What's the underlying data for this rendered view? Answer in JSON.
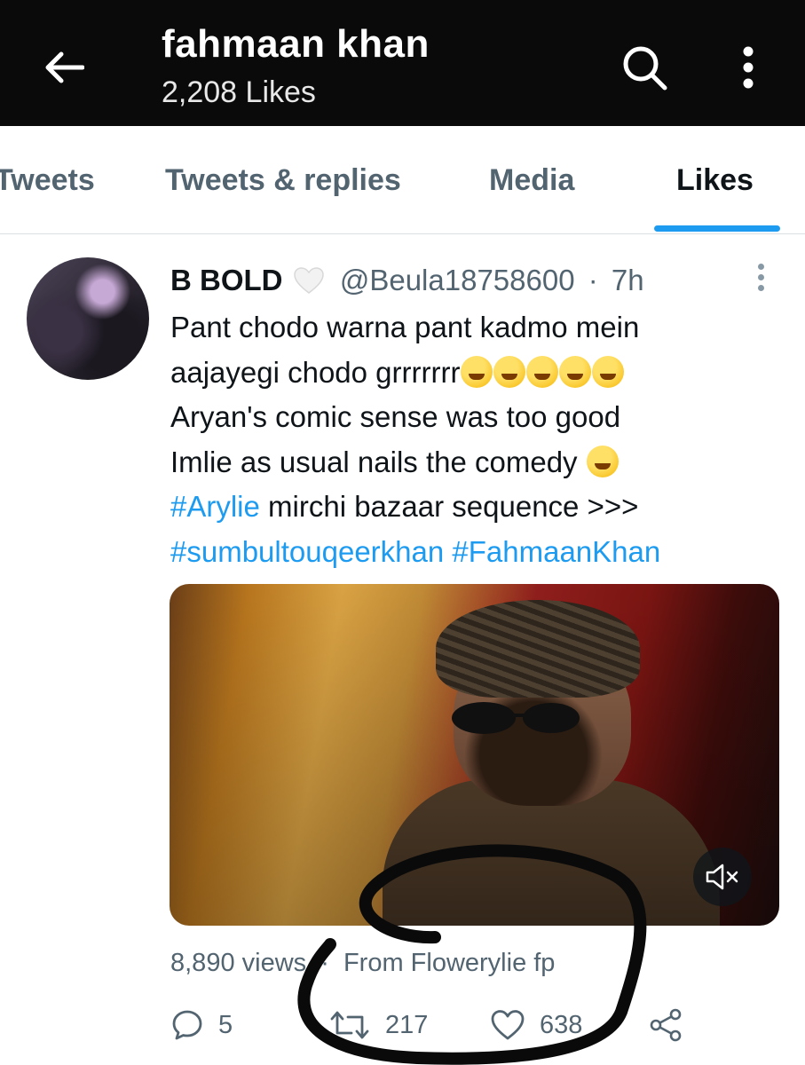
{
  "header": {
    "title": "fahmaan khan",
    "subtitle": "2,208 Likes",
    "icons": {
      "back": "back-arrow-icon",
      "search": "search-icon",
      "more": "more-vertical-icon"
    }
  },
  "tabs": [
    {
      "label": "Tweets"
    },
    {
      "label": "Tweets & replies"
    },
    {
      "label": "Media"
    },
    {
      "label": "Likes",
      "active": true
    }
  ],
  "tweet": {
    "author_name": "B BOLD",
    "author_badge_emoji": "white-heart-icon",
    "handle": "@Beula18758600",
    "separator": "·",
    "time": "7h",
    "lines": {
      "l1": "Pant chodo warna pant kadmo mein",
      "l2": "aajayegi chodo grrrrrrr",
      "l3": "Aryan's comic sense was too good",
      "l4": "Imlie as usual nails the comedy",
      "l5_tag": "#Arylie",
      "l5_rest": " mirchi bazaar sequence >>>",
      "l6_tag1": "#sumbultouqeerkhan",
      "l6_tag2": "#FahmaanKhan"
    },
    "media": {
      "type": "video",
      "mute_icon": "mute-icon"
    },
    "meta": {
      "views": "8,890 views",
      "separator": "·",
      "source": "From Flowerylie fp"
    },
    "actions": {
      "replies": "5",
      "retweets": "217",
      "likes": "638"
    }
  },
  "colors": {
    "accent": "#1d9bf0",
    "text": "#0f1419",
    "muted": "#536471",
    "header_bg": "#0a0a0a"
  }
}
